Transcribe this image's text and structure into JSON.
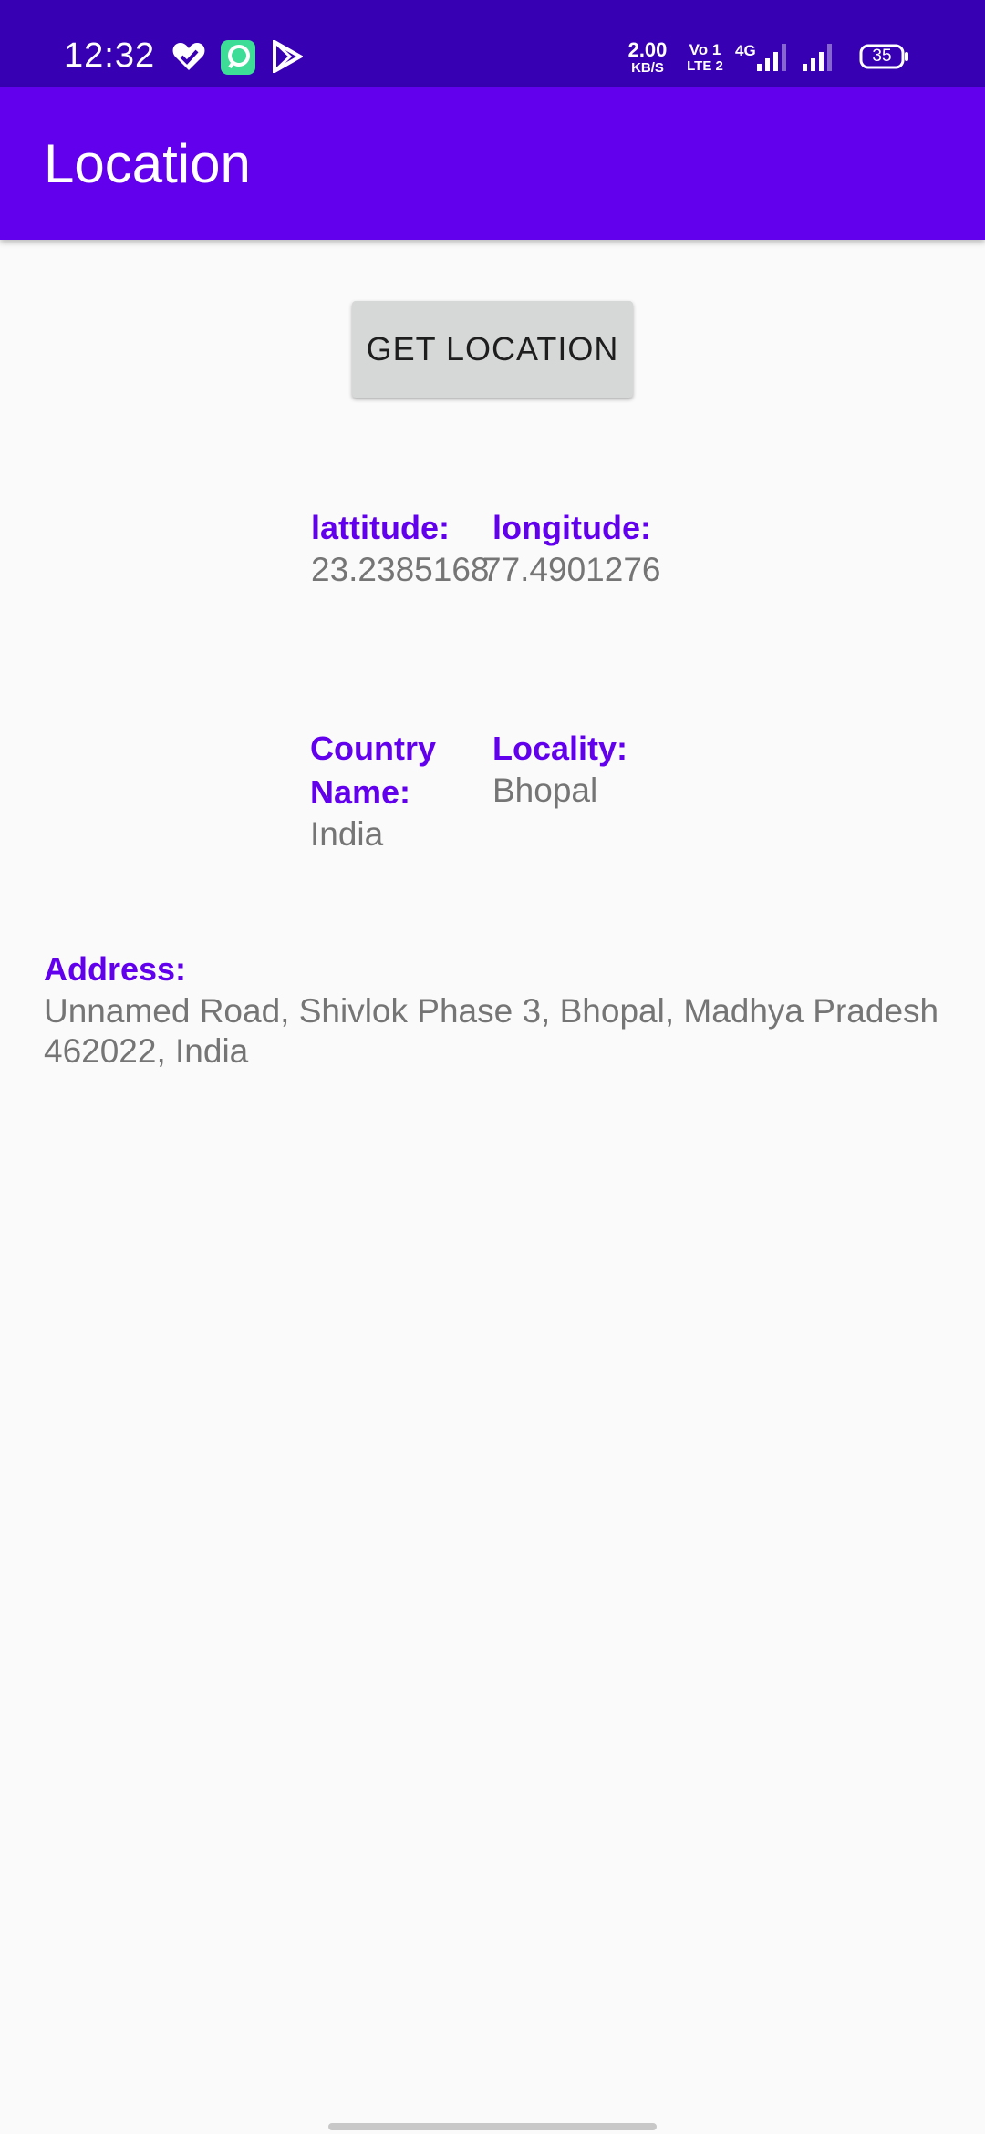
{
  "status_bar": {
    "time": "12:32",
    "net_speed_value": "2.00",
    "net_speed_unit": "KB/S",
    "volte_top": "Vo 1",
    "volte_bottom": "LTE 2",
    "network_type": "4G",
    "battery": "35",
    "icons": [
      "heart-icon",
      "chat-app-icon",
      "play-store-icon",
      "signal-icon",
      "signal-icon",
      "battery-icon"
    ]
  },
  "app_bar": {
    "title": "Location"
  },
  "actions": {
    "get_location_label": "GET LOCATION"
  },
  "location": {
    "latitude_label": "lattitude:",
    "latitude_value": "23.2385168",
    "longitude_label": "longitude:",
    "longitude_value": "77.4901276",
    "country_label_line1": "Country",
    "country_label_line2": "Name:",
    "country_value": "India",
    "locality_label": "Locality:",
    "locality_value": "Bhopal",
    "address_label": "Address:",
    "address_line1": "Unnamed Road, Shivlok Phase 3, Bhopal, Madhya Pradesh",
    "address_line2": "462022, India"
  },
  "colors": {
    "status_bar": "#3700b3",
    "app_bar": "#6200ee",
    "label": "#6200ee",
    "value": "#757575",
    "button": "#d6d7d7",
    "background": "#fafafa"
  }
}
